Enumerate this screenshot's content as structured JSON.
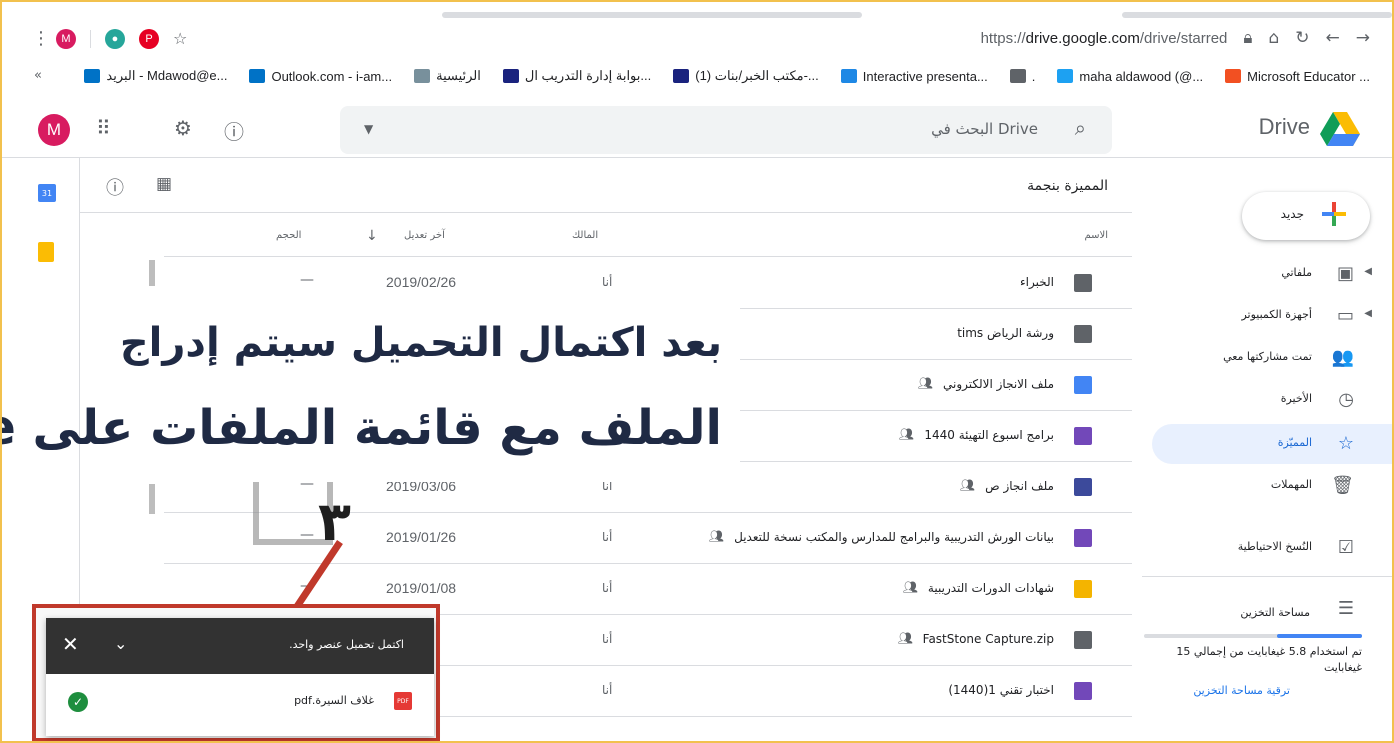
{
  "browser": {
    "url_prefix": "https://",
    "url_host": "drive.google.com",
    "url_path": "/drive/starred",
    "profile_initial": "M"
  },
  "bookmarks": [
    {
      "label": "Microsoft Educator ...",
      "color": "#f25022",
      "icon": "microsoft-icon"
    },
    {
      "label": "maha aldawood (@...",
      "color": "#1da1f2",
      "icon": "twitter-icon"
    },
    {
      "label": ".",
      "color": "#5f6368",
      "icon": "document-icon"
    },
    {
      "label": "Interactive presenta...",
      "color": "#1e88e5",
      "icon": "chart-icon"
    },
    {
      "label": "(1) مكتب الخبر/بنات-...",
      "color": "#1a237e",
      "icon": "check-icon"
    },
    {
      "label": "بوابة إدارة التدريب ال...",
      "color": "#1a237e",
      "icon": "check-icon"
    },
    {
      "label": "الرئيسية",
      "color": "#78909c",
      "icon": "spinner-icon"
    },
    {
      "label": "Outlook.com - i-am...",
      "color": "#0072c6",
      "icon": "outlook-icon"
    },
    {
      "label": "البريد - Mdawod@e...",
      "color": "#0072c6",
      "icon": "outlook-icon"
    }
  ],
  "bookmarks_more": "«",
  "header": {
    "avatar_initial": "M",
    "search_placeholder": "البحث في Drive",
    "app_title": "Drive"
  },
  "sidebar": {
    "new_label": "جديد",
    "items": [
      {
        "label": "ملفاتي",
        "icon": "my-drive-icon",
        "glyph": "▣",
        "arrow": true
      },
      {
        "label": "أجهزة الكمبيوتر",
        "icon": "computers-icon",
        "glyph": "▭",
        "arrow": true
      },
      {
        "label": "تمت مشاركتها معي",
        "icon": "shared-icon",
        "glyph": "👥",
        "arrow": false
      },
      {
        "label": "الأخيرة",
        "icon": "clock-icon",
        "glyph": "◷",
        "arrow": false
      },
      {
        "label": "المميّزة",
        "icon": "star-icon",
        "glyph": "☆",
        "arrow": false,
        "active": true
      },
      {
        "label": "المهملات",
        "icon": "trash-icon",
        "glyph": "🗑",
        "arrow": false
      },
      {
        "label": "النُسخ الاحتياطية",
        "icon": "backup-icon",
        "glyph": "☑",
        "arrow": false
      }
    ],
    "storage_label": "مساحة التخزين",
    "storage_used_fraction": 0.39,
    "storage_text": "تم استخدام 5.8 غيغابايت من إجمالي 15 غيغابايت",
    "upgrade_label": "ترقية مساحة التخزين"
  },
  "main": {
    "breadcrumb": "المميزة بنجمة",
    "columns": {
      "name": "الاسم",
      "owner": "المالك",
      "modified": "آخر تعديل",
      "size": "الحجم"
    },
    "rows": [
      {
        "name": "الخبراء",
        "owner": "أنا",
        "date": "2019/02/26",
        "size": "—",
        "icon": "shared-folder-icon",
        "color": "#5f6368",
        "shared": false
      },
      {
        "name": "ورشة الرياض tims",
        "owner": "",
        "date": "",
        "size": "",
        "icon": "shared-folder-icon",
        "color": "#5f6368",
        "shared": false
      },
      {
        "name": "ملف الانجاز الالكتروني",
        "owner": "",
        "date": "",
        "size": "",
        "icon": "docs-icon",
        "color": "#4285f4",
        "shared": true
      },
      {
        "name": "برامج اسبوع التهيئة 1440",
        "owner": "",
        "date": "",
        "size": "",
        "icon": "forms-icon",
        "color": "#7248b9",
        "shared": true
      },
      {
        "name": "ملف انجاز ص",
        "owner": "أنا",
        "date": "2019/03/06",
        "size": "—",
        "icon": "sites-icon",
        "color": "#3c4a9b",
        "shared": true
      },
      {
        "name": "بيانات الورش التدريبية والبرامج للمدارس والمكتب نسخة للتعديل",
        "owner": "أنا",
        "date": "2019/01/26",
        "size": "—",
        "icon": "forms-icon",
        "color": "#7248b9",
        "shared": true
      },
      {
        "name": "شهادات الدورات التدريبية",
        "owner": "أنا",
        "date": "2019/01/08",
        "size": "—",
        "icon": "slides-icon",
        "color": "#f4b400",
        "shared": true
      },
      {
        "name": "FastStone Capture.zip",
        "owner": "أنا",
        "date": "/02",
        "size": "",
        "icon": "zip-icon",
        "color": "#5f6368",
        "shared": true
      },
      {
        "name": "اختبار تقني 1(1440)",
        "owner": "أنا",
        "date": "/05",
        "size": "",
        "icon": "forms-icon",
        "color": "#7248b9",
        "shared": false
      }
    ]
  },
  "annotation": {
    "line1": "بعد اكتمال التحميل سيتم إدراج",
    "line2": "الملف مع قائمة الملفات على Drive",
    "step_number": "٣"
  },
  "snackbar": {
    "title": "اكتمل تحميل عنصر واحد.",
    "file_name": "غلاف السيرة.pdf",
    "file_type": "PDF"
  }
}
